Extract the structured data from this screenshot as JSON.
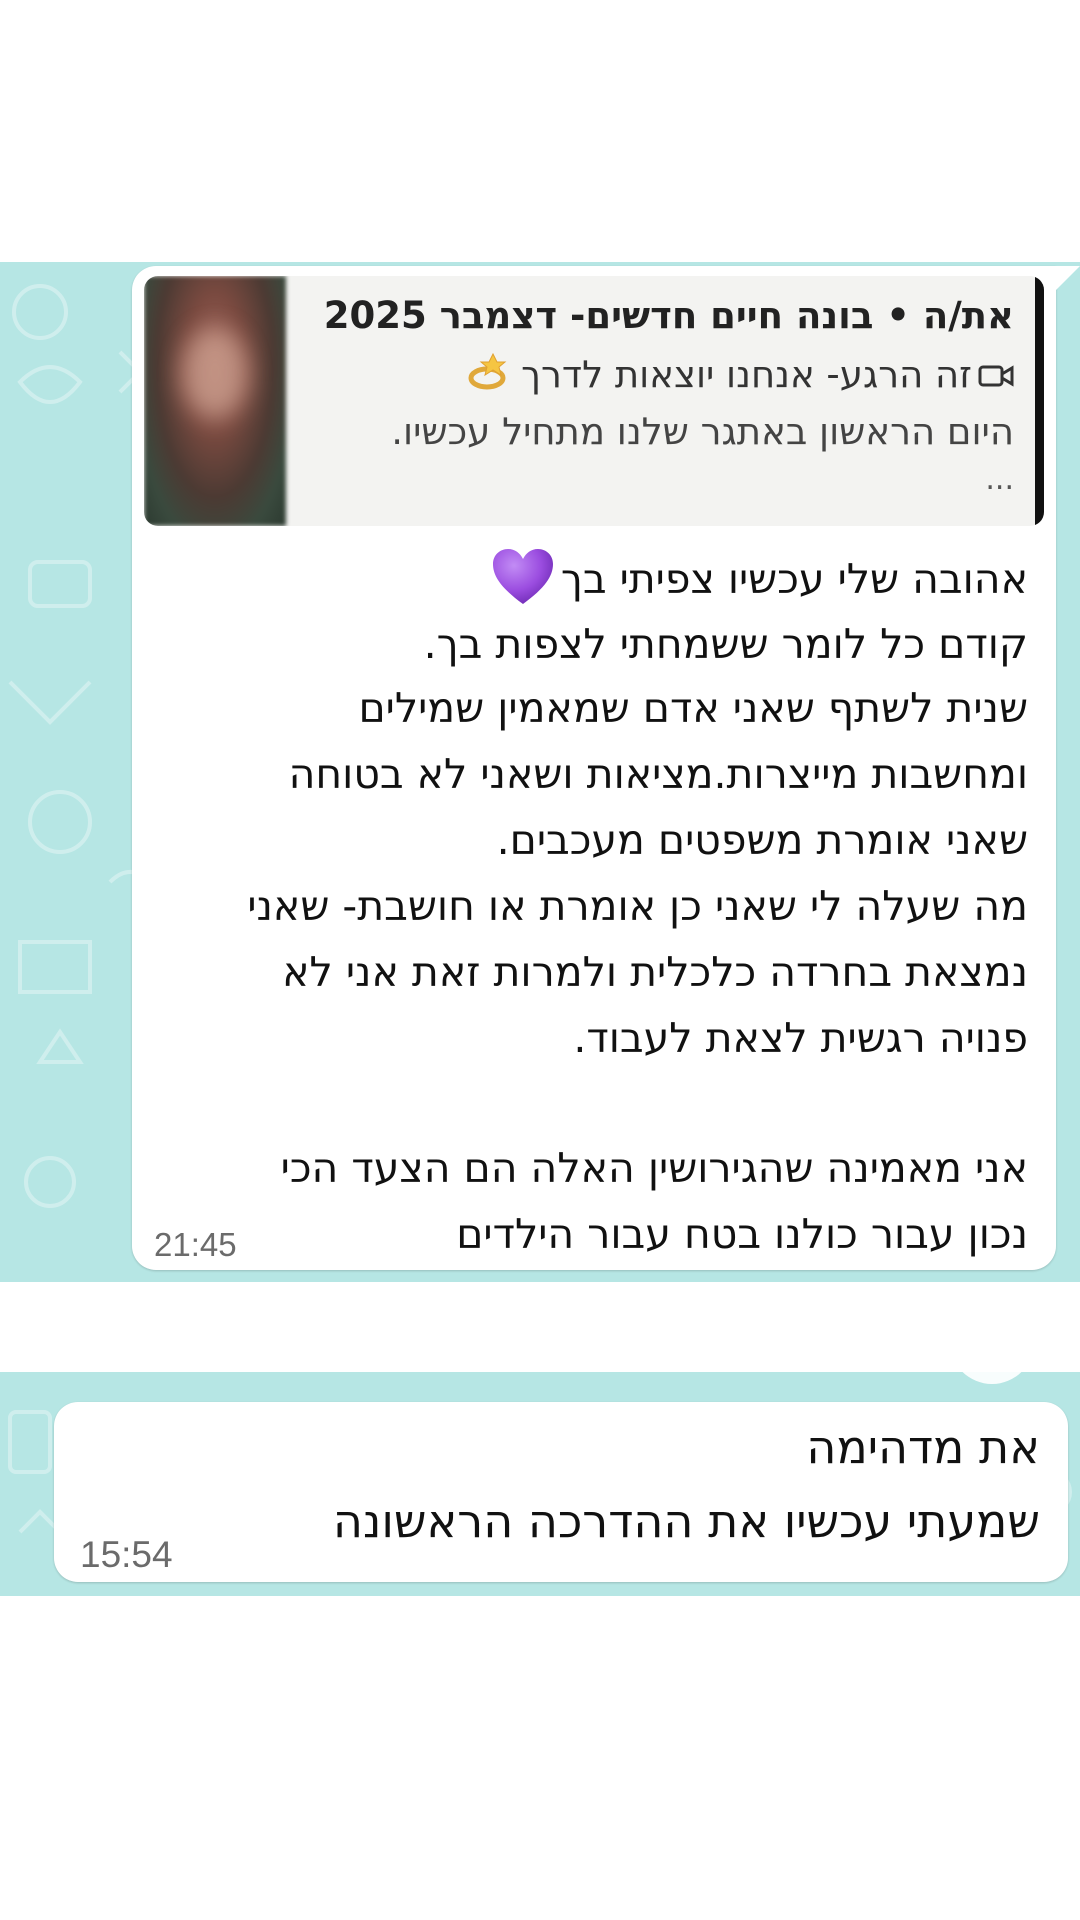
{
  "message_1": {
    "reply_preview": {
      "title": "את/ה • בונה חיים חדשים- דצמבר 2025",
      "subtitle": "זה הרגע-  אנחנו יוצאות לדרך",
      "line3": "היום הראשון באתגר שלנו מתחיל עכשיו.",
      "ellipsis": "..."
    },
    "lines": [
      "אהובה שלי עכשיו צפיתי בך",
      "קודם כל לומר ששמחתי לצפות בך.",
      "שנית לשתף שאני אדם שמאמין שמילים",
      "ומחשבות מייצרות.מציאות ושאני לא בטוחה",
      "שאני אומרת משפטים מעכבים.",
      " מה שעלה לי שאני כן אומרת או חושבת- שאני",
      "נמצאת בחרדה כלכלית ולמרות זאת אני לא",
      "פנויה רגשית לצאת לעבוד.",
      "אני מאמינה שהגירושין האלה הם הצעד הכי",
      "נכון עבור כולנו בטח עבור הילדים"
    ],
    "time": "21:45"
  },
  "message_2": {
    "lines": [
      "את מדהימה",
      "שמעתי עכשיו את ההדרכה הראשונה"
    ],
    "time": "15:54"
  },
  "icons": {
    "reply_video": "video-camera-icon",
    "reply_ring": "ring-icon",
    "heart": "purple-heart-icon"
  },
  "colors": {
    "chat_background": "#b6e6e4",
    "bubble": "#ffffff",
    "heart": "#9b4de0"
  }
}
